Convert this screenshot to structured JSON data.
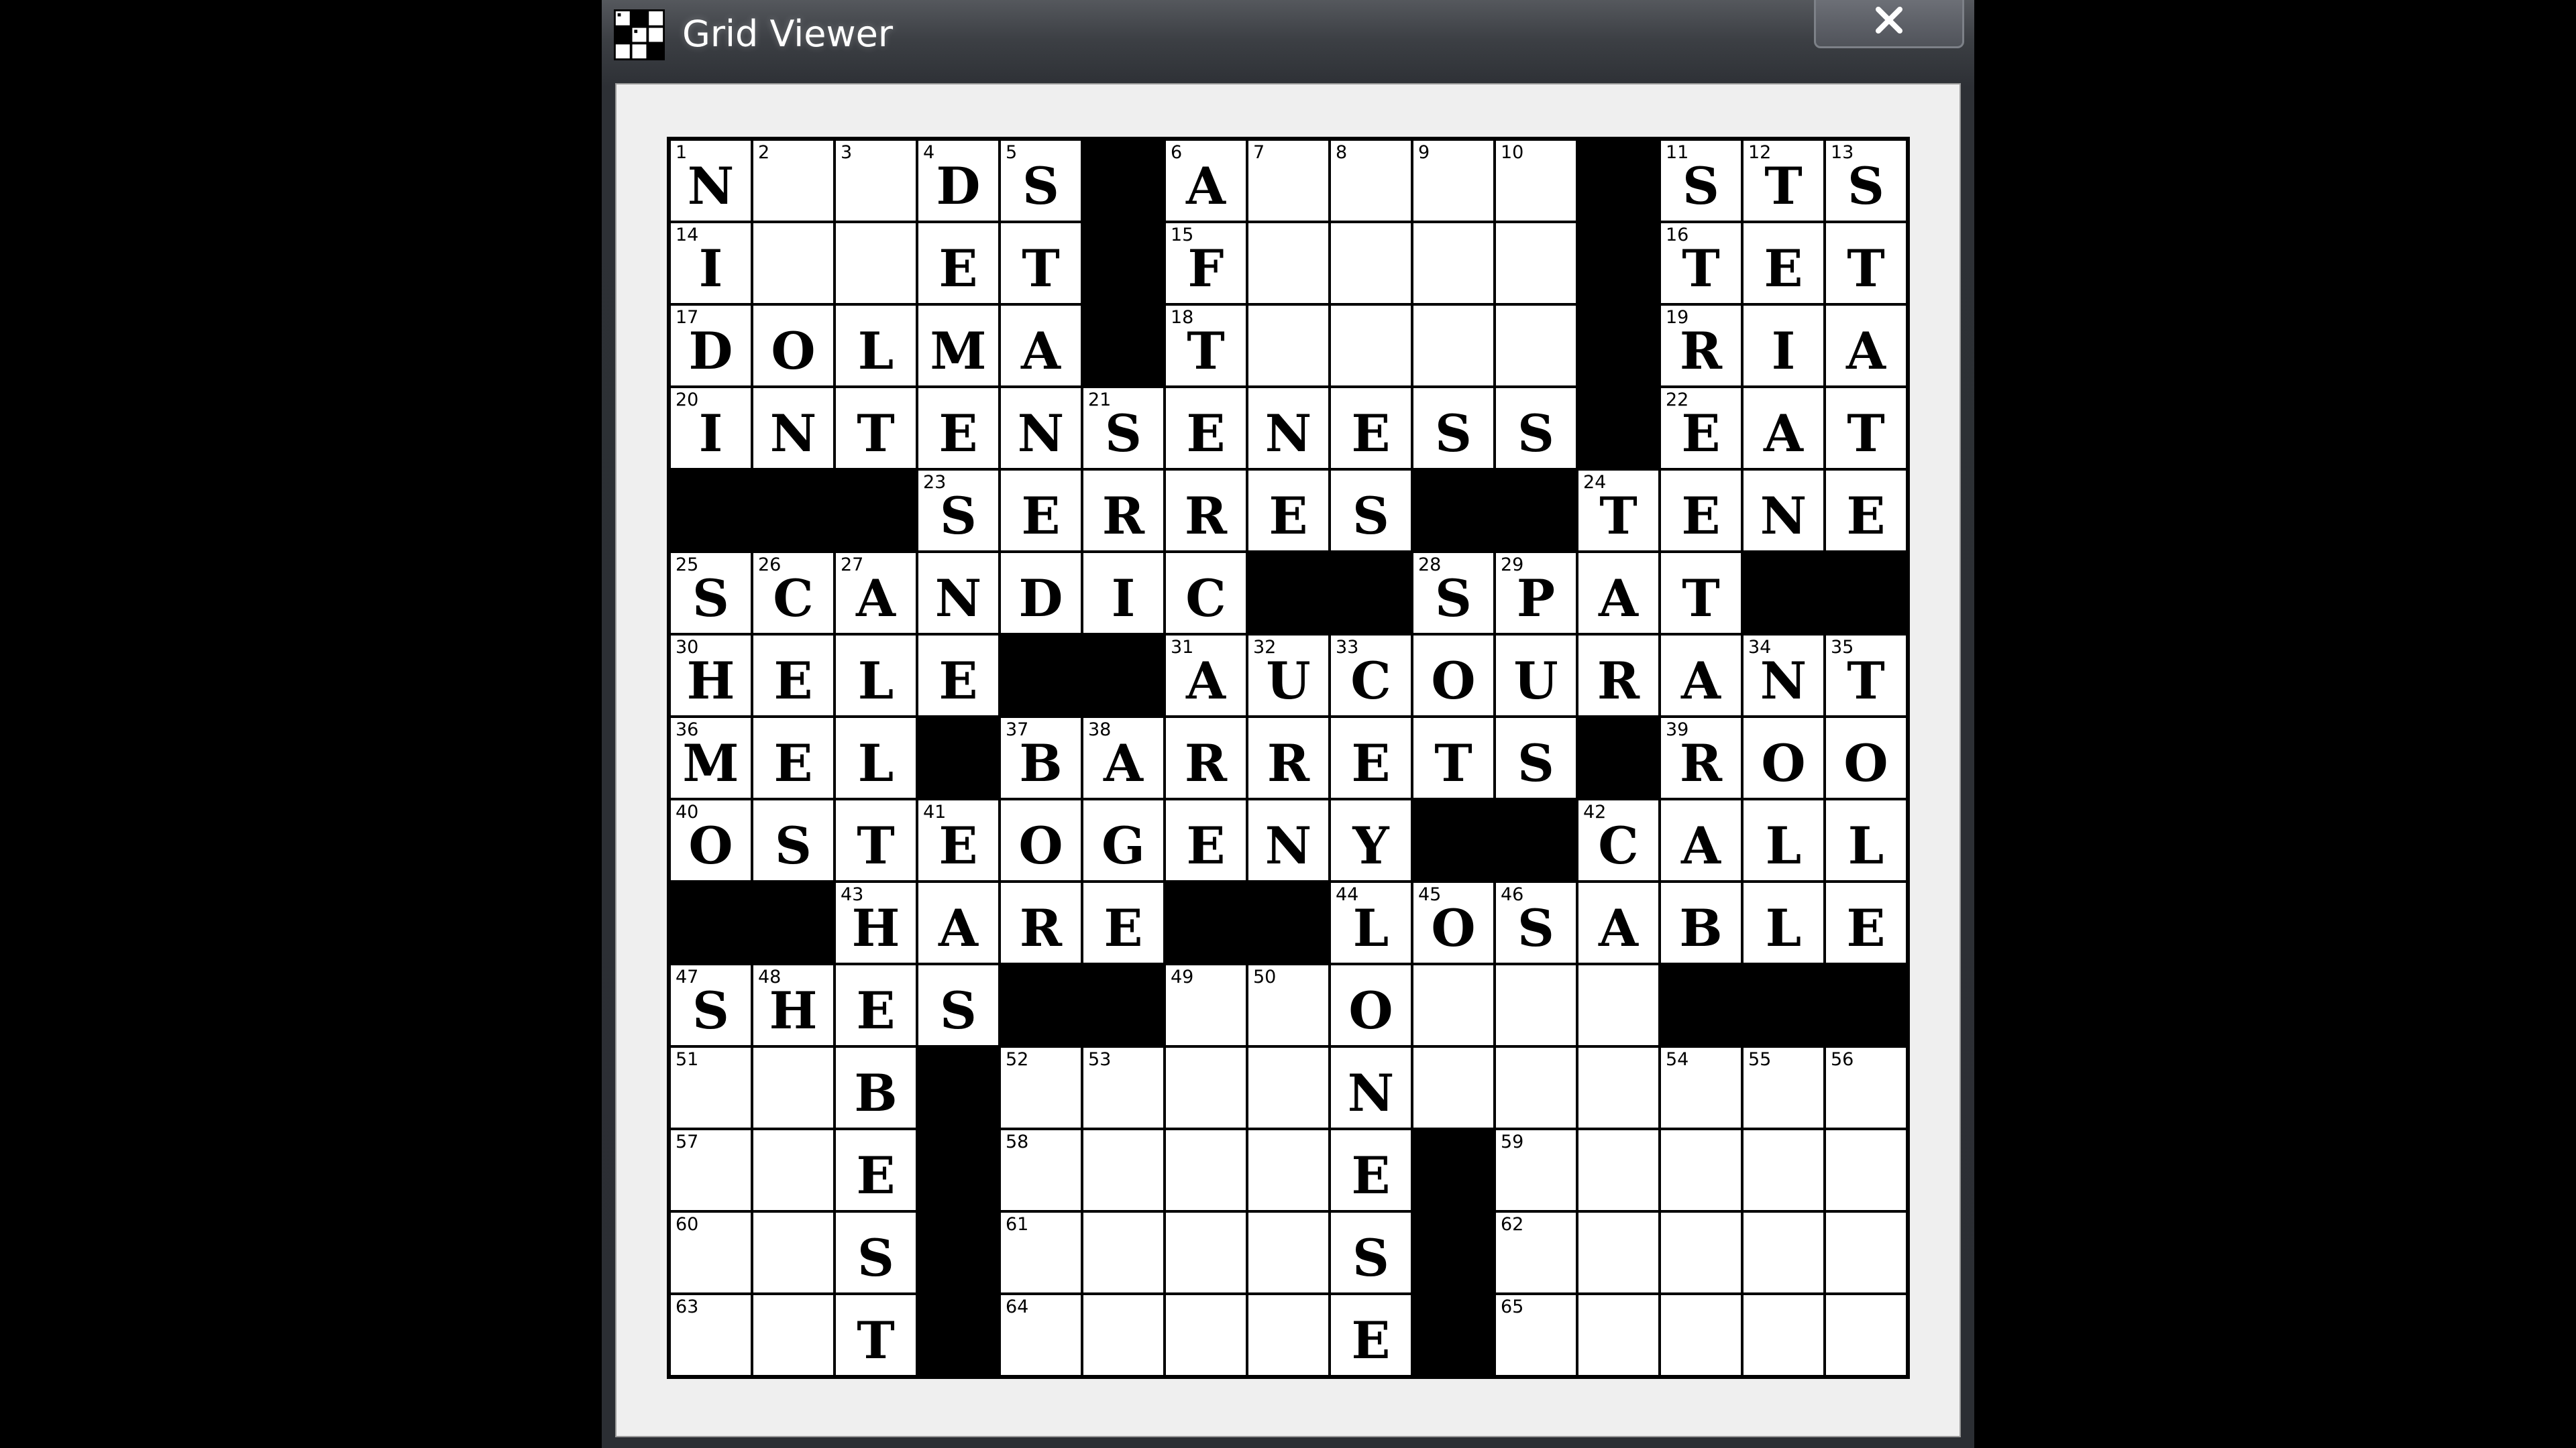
{
  "window": {
    "title": "Grid Viewer",
    "app_icon": "crossword-grid-icon",
    "close_icon": "close-x-icon",
    "close_label": "✕"
  },
  "colors": {
    "desktop_bg": "#000000",
    "titlebar": "#3c3f44",
    "client_bg": "#efefef",
    "cell_white": "#ffffff",
    "cell_black": "#000000"
  },
  "grid": {
    "rows": 15,
    "cols": 15,
    "solution": [
      "NDDS#A....#STS",
      "I..ET#F....#TET",
      "DOLMA#T....#RIA",
      "INTENSENESS#EAT",
      "###SERRES##TENE",
      "SCANDIC##SPAT##",
      "HELE##AUCOURANT",
      "MEL#BARRETS#ROO",
      "OSTEOGENY##CALL",
      "##HARE##LOSABLE",
      "SHES##..O...###",
      "..B#...N......",
      "..E#....E#.....",
      "..S#....S#.....",
      "..T#....E#....."
    ],
    "rows_data": [
      [
        "N",
        "",
        "",
        "D",
        "S",
        "#",
        "A",
        "",
        "",
        "",
        "",
        "#",
        "S",
        "T",
        "S"
      ],
      [
        "I",
        "",
        "",
        "E",
        "T",
        "#",
        "F",
        "",
        "",
        "",
        "",
        "#",
        "T",
        "E",
        "T"
      ],
      [
        "D",
        "O",
        "L",
        "M",
        "A",
        "#",
        "T",
        "",
        "",
        "",
        "",
        "#",
        "R",
        "I",
        "A"
      ],
      [
        "I",
        "N",
        "T",
        "E",
        "N",
        "S",
        "E",
        "N",
        "E",
        "S",
        "S",
        "#",
        "E",
        "A",
        "T"
      ],
      [
        "#",
        "#",
        "#",
        "S",
        "E",
        "R",
        "R",
        "E",
        "S",
        "#",
        "#",
        "T",
        "E",
        "N",
        "E"
      ],
      [
        "S",
        "C",
        "A",
        "N",
        "D",
        "I",
        "C",
        "#",
        "#",
        "S",
        "P",
        "A",
        "T",
        "#",
        "#"
      ],
      [
        "H",
        "E",
        "L",
        "E",
        "#",
        "#",
        "A",
        "U",
        "C",
        "O",
        "U",
        "R",
        "A",
        "N",
        "T"
      ],
      [
        "M",
        "E",
        "L",
        "#",
        "B",
        "A",
        "R",
        "R",
        "E",
        "T",
        "S",
        "#",
        "R",
        "O",
        "O"
      ],
      [
        "O",
        "S",
        "T",
        "E",
        "O",
        "G",
        "E",
        "N",
        "Y",
        "#",
        "#",
        "C",
        "A",
        "L",
        "L"
      ],
      [
        "#",
        "#",
        "H",
        "A",
        "R",
        "E",
        "#",
        "#",
        "L",
        "O",
        "S",
        "A",
        "B",
        "L",
        "E"
      ],
      [
        "S",
        "H",
        "E",
        "S",
        "#",
        "#",
        "",
        "",
        "O",
        "",
        "",
        "",
        "#",
        "#",
        "#"
      ],
      [
        "",
        "",
        "B",
        "#",
        "",
        "",
        "",
        "",
        "N",
        "",
        "",
        "",
        "",
        "",
        ""
      ],
      [
        "",
        "",
        "E",
        "#",
        "",
        "",
        "",
        "",
        "E",
        "#",
        "",
        "",
        "",
        "",
        ""
      ],
      [
        "",
        "",
        "S",
        "#",
        "",
        "",
        "",
        "",
        "S",
        "#",
        "",
        "",
        "",
        "",
        ""
      ],
      [
        "",
        "",
        "T",
        "#",
        "",
        "",
        "",
        "",
        "E",
        "#",
        "",
        "",
        "",
        "",
        ""
      ]
    ],
    "numbers": [
      [
        1,
        2,
        3,
        4,
        5,
        0,
        6,
        7,
        8,
        9,
        10,
        0,
        11,
        12,
        13
      ],
      [
        14,
        0,
        0,
        0,
        0,
        0,
        15,
        0,
        0,
        0,
        0,
        0,
        16,
        0,
        0
      ],
      [
        17,
        0,
        0,
        0,
        0,
        0,
        18,
        0,
        0,
        0,
        0,
        0,
        19,
        0,
        0
      ],
      [
        20,
        0,
        0,
        0,
        0,
        21,
        0,
        0,
        0,
        0,
        0,
        0,
        22,
        0,
        0
      ],
      [
        0,
        0,
        0,
        23,
        0,
        0,
        0,
        0,
        0,
        0,
        0,
        24,
        0,
        0,
        0
      ],
      [
        25,
        26,
        27,
        0,
        0,
        0,
        0,
        0,
        0,
        28,
        29,
        0,
        0,
        0,
        0
      ],
      [
        30,
        0,
        0,
        0,
        0,
        0,
        31,
        32,
        33,
        0,
        0,
        0,
        0,
        34,
        35
      ],
      [
        36,
        0,
        0,
        0,
        37,
        38,
        0,
        0,
        0,
        0,
        0,
        0,
        39,
        0,
        0
      ],
      [
        40,
        0,
        0,
        41,
        0,
        0,
        0,
        0,
        0,
        0,
        0,
        42,
        0,
        0,
        0
      ],
      [
        0,
        0,
        43,
        0,
        0,
        0,
        0,
        0,
        44,
        45,
        46,
        0,
        0,
        0,
        0
      ],
      [
        47,
        48,
        0,
        0,
        0,
        0,
        49,
        50,
        0,
        0,
        0,
        0,
        0,
        0,
        0
      ],
      [
        51,
        0,
        0,
        0,
        52,
        53,
        0,
        0,
        0,
        0,
        0,
        0,
        54,
        55,
        56
      ],
      [
        57,
        0,
        0,
        0,
        58,
        0,
        0,
        0,
        0,
        0,
        59,
        0,
        0,
        0,
        0
      ],
      [
        60,
        0,
        0,
        0,
        61,
        0,
        0,
        0,
        0,
        0,
        62,
        0,
        0,
        0,
        0
      ],
      [
        63,
        0,
        0,
        0,
        64,
        0,
        0,
        0,
        0,
        0,
        65,
        0,
        0,
        0,
        0
      ]
    ]
  }
}
